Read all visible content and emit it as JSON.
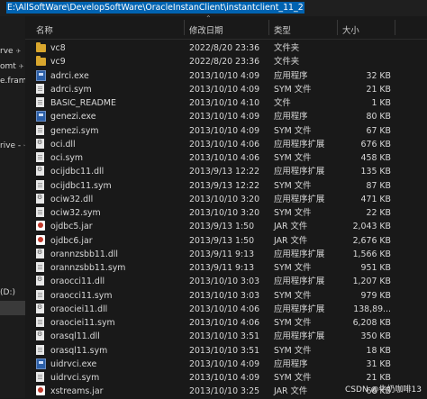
{
  "address_bar": {
    "path": "E:\\AllSoftWare\\DevelopSoftWare\\OracleInstanClient\\instantclient_11_2"
  },
  "sidebar": {
    "items": [
      {
        "label": "rve",
        "pin": "✈"
      },
      {
        "label": "omt",
        "pin": "✈"
      },
      {
        "label": "e.fram",
        "pin": ""
      },
      {
        "label": "rive -",
        "pin": "✈"
      },
      {
        "label": "(D:)",
        "pin": ""
      }
    ]
  },
  "columns": {
    "name": "名称",
    "date": "修改日期",
    "type": "类型",
    "size": "大小"
  },
  "files": [
    {
      "icon": "folder-icon",
      "name": "vc8",
      "date": "2022/8/20 23:36",
      "type": "文件夹",
      "size": ""
    },
    {
      "icon": "folder-icon",
      "name": "vc9",
      "date": "2022/8/20 23:36",
      "type": "文件夹",
      "size": ""
    },
    {
      "icon": "exe-icon",
      "name": "adrci.exe",
      "date": "2013/10/10 4:09",
      "type": "应用程序",
      "size": "32 KB"
    },
    {
      "icon": "file-icon",
      "name": "adrci.sym",
      "date": "2013/10/10 4:09",
      "type": "SYM 文件",
      "size": "21 KB"
    },
    {
      "icon": "file-icon",
      "name": "BASIC_README",
      "date": "2013/10/10 4:10",
      "type": "文件",
      "size": "1 KB"
    },
    {
      "icon": "exe-icon",
      "name": "genezi.exe",
      "date": "2013/10/10 4:09",
      "type": "应用程序",
      "size": "80 KB"
    },
    {
      "icon": "file-icon",
      "name": "genezi.sym",
      "date": "2013/10/10 4:09",
      "type": "SYM 文件",
      "size": "67 KB"
    },
    {
      "icon": "dll-icon",
      "name": "oci.dll",
      "date": "2013/10/10 4:06",
      "type": "应用程序扩展",
      "size": "676 KB"
    },
    {
      "icon": "file-icon",
      "name": "oci.sym",
      "date": "2013/10/10 4:06",
      "type": "SYM 文件",
      "size": "458 KB"
    },
    {
      "icon": "dll-icon",
      "name": "ocijdbc11.dll",
      "date": "2013/9/13 12:22",
      "type": "应用程序扩展",
      "size": "135 KB"
    },
    {
      "icon": "file-icon",
      "name": "ocijdbc11.sym",
      "date": "2013/9/13 12:22",
      "type": "SYM 文件",
      "size": "87 KB"
    },
    {
      "icon": "dll-icon",
      "name": "ociw32.dll",
      "date": "2013/10/10 3:20",
      "type": "应用程序扩展",
      "size": "471 KB"
    },
    {
      "icon": "file-icon",
      "name": "ociw32.sym",
      "date": "2013/10/10 3:20",
      "type": "SYM 文件",
      "size": "22 KB"
    },
    {
      "icon": "jar-icon",
      "name": "ojdbc5.jar",
      "date": "2013/9/13 1:50",
      "type": "JAR 文件",
      "size": "2,043 KB"
    },
    {
      "icon": "jar-icon",
      "name": "ojdbc6.jar",
      "date": "2013/9/13 1:50",
      "type": "JAR 文件",
      "size": "2,676 KB"
    },
    {
      "icon": "dll-icon",
      "name": "orannzsbb11.dll",
      "date": "2013/9/11 9:13",
      "type": "应用程序扩展",
      "size": "1,566 KB"
    },
    {
      "icon": "file-icon",
      "name": "orannzsbb11.sym",
      "date": "2013/9/11 9:13",
      "type": "SYM 文件",
      "size": "951 KB"
    },
    {
      "icon": "dll-icon",
      "name": "oraocci11.dll",
      "date": "2013/10/10 3:03",
      "type": "应用程序扩展",
      "size": "1,207 KB"
    },
    {
      "icon": "file-icon",
      "name": "oraocci11.sym",
      "date": "2013/10/10 3:03",
      "type": "SYM 文件",
      "size": "979 KB"
    },
    {
      "icon": "dll-icon",
      "name": "oraociei11.dll",
      "date": "2013/10/10 4:06",
      "type": "应用程序扩展",
      "size": "138,89..."
    },
    {
      "icon": "file-icon",
      "name": "oraociei11.sym",
      "date": "2013/10/10 4:06",
      "type": "SYM 文件",
      "size": "6,208 KB"
    },
    {
      "icon": "dll-icon",
      "name": "orasql11.dll",
      "date": "2013/10/10 3:51",
      "type": "应用程序扩展",
      "size": "350 KB"
    },
    {
      "icon": "file-icon",
      "name": "orasql11.sym",
      "date": "2013/10/10 3:51",
      "type": "SYM 文件",
      "size": "18 KB"
    },
    {
      "icon": "exe-icon",
      "name": "uidrvci.exe",
      "date": "2013/10/10 4:09",
      "type": "应用程序",
      "size": "31 KB"
    },
    {
      "icon": "file-icon",
      "name": "uidrvci.sym",
      "date": "2013/10/10 4:09",
      "type": "SYM 文件",
      "size": "21 KB"
    },
    {
      "icon": "jar-icon",
      "name": "xstreams.jar",
      "date": "2013/10/10 3:25",
      "type": "JAR 文件",
      "size": "66 KB"
    }
  ],
  "watermark": "CSDN @牛奶咖啡13"
}
